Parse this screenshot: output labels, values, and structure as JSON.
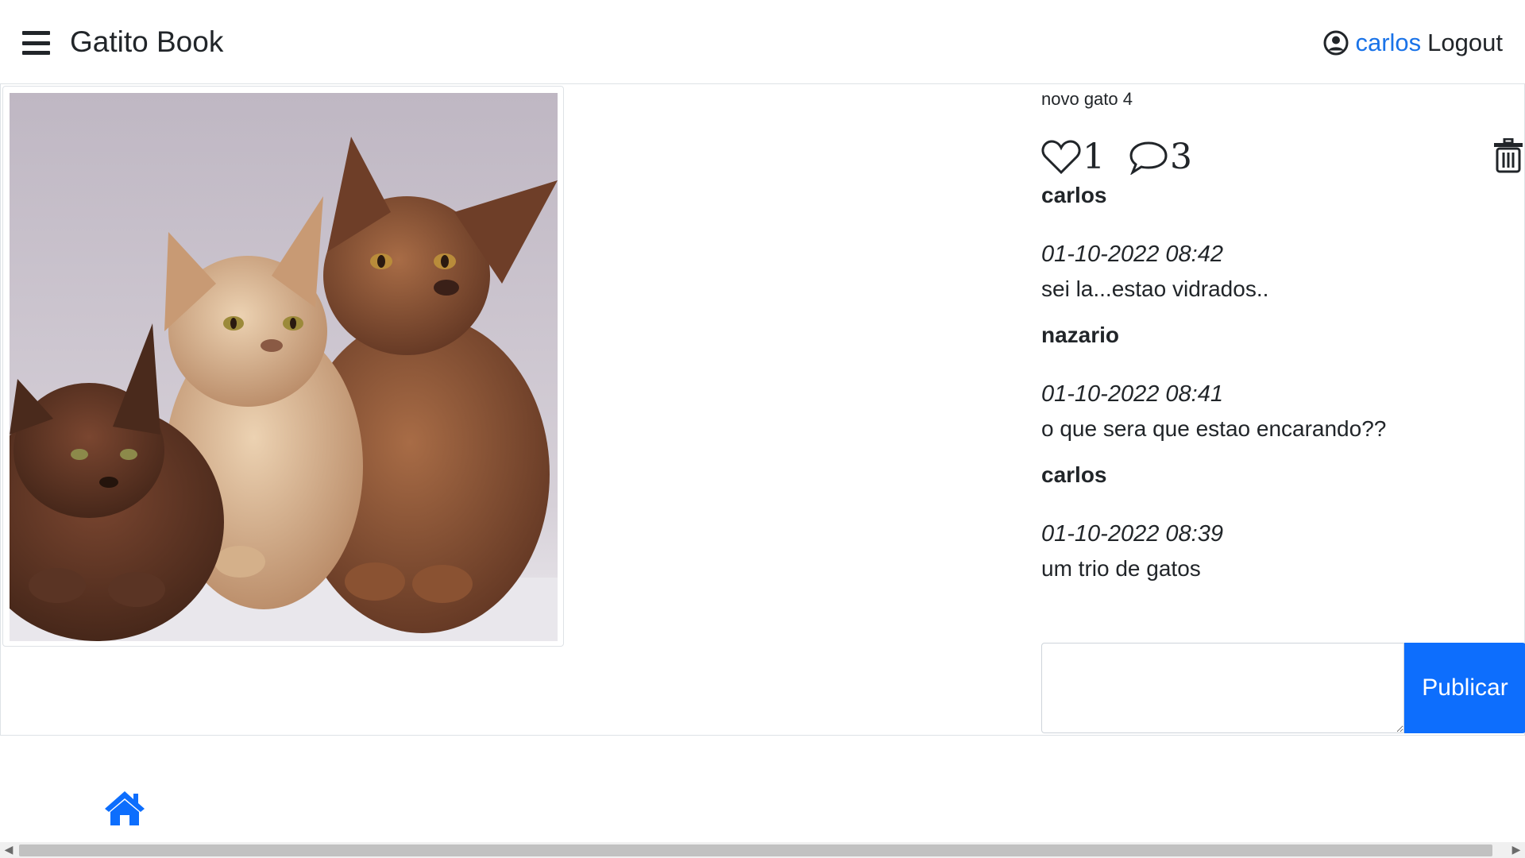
{
  "header": {
    "menu_icon": "hamburger-icon",
    "brand": "Gatito Book",
    "user_icon": "user-circle-icon",
    "username": "carlos",
    "logout": "Logout"
  },
  "photo": {
    "alt_icon": "photo-kittens",
    "description": "novo gato 4",
    "likes": "1",
    "comments_count": "3",
    "like_icon": "heart-icon",
    "comment_icon": "speech-bubble-icon",
    "delete_icon": "trash-icon"
  },
  "comments": [
    {
      "user": "carlos",
      "date": "01-10-2022 08:42",
      "text": "sei la...estao vidrados.."
    },
    {
      "user": "nazario",
      "date": "01-10-2022 08:41",
      "text": "o que sera que estao encarando??"
    },
    {
      "user": "carlos",
      "date": "01-10-2022 08:39",
      "text": "um trio de gatos"
    }
  ],
  "form": {
    "placeholder": "",
    "submit_label": "Publicar"
  },
  "footer": {
    "home_icon": "home-icon"
  },
  "colors": {
    "accent": "#0d6efd",
    "link": "#1a73e8",
    "text": "#212529",
    "border": "#dee2e6"
  }
}
